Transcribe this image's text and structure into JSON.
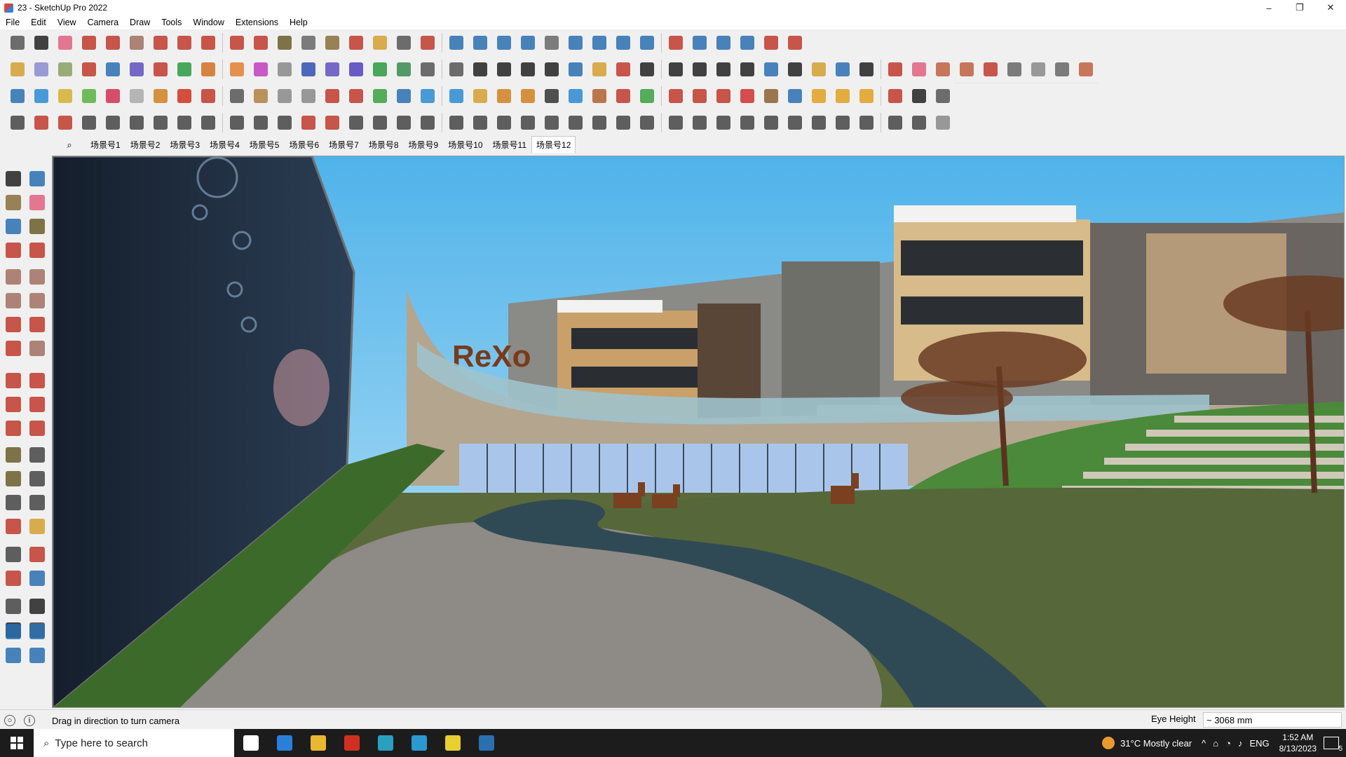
{
  "window": {
    "title": "23 - SketchUp Pro 2022",
    "minimize": "–",
    "maximize": "❐",
    "close": "✕"
  },
  "menu": [
    "File",
    "Edit",
    "View",
    "Camera",
    "Draw",
    "Tools",
    "Window",
    "Extensions",
    "Help"
  ],
  "toolbars": {
    "row1": [
      {
        "name": "zoom-icon",
        "color": "#555555"
      },
      {
        "name": "select-icon",
        "color": "#222222"
      },
      {
        "name": "eraser-icon",
        "color": "#e06080"
      },
      {
        "name": "pencil-icon",
        "color": "#c0392b"
      },
      {
        "name": "arc-icon",
        "color": "#c0392b"
      },
      {
        "name": "rectangle-icon",
        "color": "#a07060"
      },
      {
        "name": "push-pull-icon",
        "color": "#c0392b"
      },
      {
        "name": "follow-me-icon",
        "color": "#c0392b"
      },
      {
        "name": "move-icon",
        "color": "#c0392b"
      },
      {
        "name": "rotate-icon",
        "color": "#c0392b"
      },
      {
        "name": "scale-icon",
        "color": "#c0392b"
      },
      {
        "name": "tape-measure-icon",
        "color": "#6a5d2a"
      },
      {
        "name": "text-icon",
        "color": "#666666"
      },
      {
        "name": "paint-bucket-icon",
        "color": "#8a6d3b"
      },
      {
        "name": "orbit-icon",
        "color": "#c0392b"
      },
      {
        "name": "pan-icon",
        "color": "#d4a030"
      },
      {
        "name": "zoom-tool-icon",
        "color": "#555555"
      },
      {
        "name": "zoom-extents-icon",
        "color": "#c0392b"
      },
      {
        "name": "warehouse-icon",
        "color": "#2a6fb0"
      },
      {
        "name": "extension-warehouse-icon",
        "color": "#2a6fb0"
      },
      {
        "name": "layout-icon",
        "color": "#2a6fb0"
      },
      {
        "name": "extension-manager-icon",
        "color": "#2a6fb0"
      },
      {
        "name": "user-icon",
        "color": "#666666"
      },
      {
        "name": "section-plane-icon",
        "color": "#2a6fb0"
      },
      {
        "name": "section-display-icon",
        "color": "#2a6fb0"
      },
      {
        "name": "section-fill-icon",
        "color": "#2a6fb0"
      },
      {
        "name": "arrows-up-icon",
        "color": "#2a6fb0"
      },
      {
        "name": "arrows-down-icon",
        "color": "#c0392b"
      },
      {
        "name": "dimension-icon",
        "color": "#2a6fb0"
      },
      {
        "name": "model-info-icon",
        "color": "#2a6fb0"
      },
      {
        "name": "undo-icon",
        "color": "#2a6fb0"
      },
      {
        "name": "redo-icon",
        "color": "#c0392b"
      },
      {
        "name": "preferences-icon",
        "color": "#c0392b"
      }
    ],
    "row2": [
      {
        "name": "iso-view-icon",
        "color": "#d4a030"
      },
      {
        "name": "top-view-icon",
        "color": "#8a8ad0"
      },
      {
        "name": "front-view-icon",
        "color": "#8aa060"
      },
      {
        "name": "push-pull-red-icon",
        "color": "#c0392b"
      },
      {
        "name": "extrude-blue-icon",
        "color": "#2a6fb0"
      },
      {
        "name": "extrude-purple-icon",
        "color": "#6050c0"
      },
      {
        "name": "extrude-red-icon",
        "color": "#c0392b"
      },
      {
        "name": "extrude-green-icon",
        "color": "#2a9a40"
      },
      {
        "name": "extrude-orange-icon",
        "color": "#d07020"
      },
      {
        "name": "extrude-orange2-icon",
        "color": "#e08030"
      },
      {
        "name": "extrude-magenta-icon",
        "color": "#c040c0"
      },
      {
        "name": "curve-icon",
        "color": "#888888"
      },
      {
        "name": "face-blue-icon",
        "color": "#3050b0"
      },
      {
        "name": "face-purple-icon",
        "color": "#6050c0"
      },
      {
        "name": "face-violet-icon",
        "color": "#5040c0"
      },
      {
        "name": "plane-green-icon",
        "color": "#2a9a40"
      },
      {
        "name": "plane-green2-icon",
        "color": "#3a8a50"
      },
      {
        "name": "house-icon",
        "color": "#555555"
      },
      {
        "name": "house2-icon",
        "color": "#555555"
      },
      {
        "name": "house3-icon",
        "color": "#222222"
      },
      {
        "name": "house4-icon",
        "color": "#222222"
      },
      {
        "name": "house5-icon",
        "color": "#222222"
      },
      {
        "name": "house6-icon",
        "color": "#222222"
      },
      {
        "name": "graph-icon",
        "color": "#2a6fb0"
      },
      {
        "name": "shape-icon",
        "color": "#d4a030"
      },
      {
        "name": "pencil-red-icon",
        "color": "#c0392b"
      },
      {
        "name": "shape-square-icon",
        "color": "#222222"
      },
      {
        "name": "shape-circle-icon",
        "color": "#222222"
      },
      {
        "name": "shape-hexagon-icon",
        "color": "#222222"
      },
      {
        "name": "shape-ellipse-icon",
        "color": "#222222"
      },
      {
        "name": "shape-parallelogram-icon",
        "color": "#222222"
      },
      {
        "name": "shape-arc-icon",
        "color": "#2a6fb0"
      },
      {
        "name": "shape-ring-icon",
        "color": "#222222"
      },
      {
        "name": "shape-spiral-icon",
        "color": "#d4a030"
      },
      {
        "name": "shape-polygon-icon",
        "color": "#2a6fb0"
      },
      {
        "name": "shape-torus-icon",
        "color": "#222222"
      },
      {
        "name": "line-red-icon",
        "color": "#c0392b"
      },
      {
        "name": "eraser-pink-icon",
        "color": "#e06080"
      },
      {
        "name": "render-1-icon",
        "color": "#c06040"
      },
      {
        "name": "render-2-icon",
        "color": "#c06040"
      },
      {
        "name": "render-3-icon",
        "color": "#c0392b"
      },
      {
        "name": "render-4-icon",
        "color": "#666666"
      },
      {
        "name": "render-5-icon",
        "color": "#888888"
      },
      {
        "name": "render-6-icon",
        "color": "#666666"
      },
      {
        "name": "render-7-icon",
        "color": "#c06040"
      }
    ],
    "row3": [
      {
        "name": "layer-1-icon",
        "color": "#2a6fb0"
      },
      {
        "name": "layer-2-icon",
        "color": "#2a8ad0"
      },
      {
        "name": "layer-3-icon",
        "color": "#d4b030"
      },
      {
        "name": "layer-4-icon",
        "color": "#5ab040"
      },
      {
        "name": "layer-5-icon",
        "color": "#d03050"
      },
      {
        "name": "layer-6-icon",
        "color": "#aaaaaa"
      },
      {
        "name": "curl-icon",
        "color": "#d08020"
      },
      {
        "name": "stop-icon",
        "color": "#d03020"
      },
      {
        "name": "grid-icon",
        "color": "#c0392b"
      },
      {
        "name": "wall-icon",
        "color": "#555555"
      },
      {
        "name": "box-icon",
        "color": "#b08040"
      },
      {
        "name": "chain-icon",
        "color": "#888888"
      },
      {
        "name": "bend-icon",
        "color": "#888888"
      },
      {
        "name": "dots-curve-icon",
        "color": "#c0392b"
      },
      {
        "name": "plus-red-icon",
        "color": "#c0392b"
      },
      {
        "name": "plus-green-icon",
        "color": "#3aa040"
      },
      {
        "name": "x-blue-icon",
        "color": "#2a6fb0"
      },
      {
        "name": "flask-icon",
        "color": "#2a8ad0"
      },
      {
        "name": "flask2-icon",
        "color": "#2a8ad0"
      },
      {
        "name": "triangle-icon",
        "color": "#d4a030"
      },
      {
        "name": "ring-orange-icon",
        "color": "#d08020"
      },
      {
        "name": "ring-x-icon",
        "color": "#d08020"
      },
      {
        "name": "ring-dots-icon",
        "color": "#333333"
      },
      {
        "name": "star-icon",
        "color": "#2a8ad0"
      },
      {
        "name": "cup-icon",
        "color": "#b06030"
      },
      {
        "name": "magnet-icon",
        "color": "#c0392b"
      },
      {
        "name": "tree-icon",
        "color": "#3aa040"
      },
      {
        "name": "hammer-icon",
        "color": "#c0392b"
      },
      {
        "name": "tool-a-icon",
        "color": "#c0392b"
      },
      {
        "name": "tool-b-icon",
        "color": "#c0392b"
      },
      {
        "name": "gem-icon",
        "color": "#d03030"
      },
      {
        "name": "net-icon",
        "color": "#8a6030"
      },
      {
        "name": "cube-outline-icon",
        "color": "#2a6fb0"
      },
      {
        "name": "hatch-orange-icon",
        "color": "#e0a020"
      },
      {
        "name": "grid-orange-icon",
        "color": "#e0a020"
      },
      {
        "name": "grid-yellow-icon",
        "color": "#e0a020"
      },
      {
        "name": "scatter-icon",
        "color": "#c0392b"
      },
      {
        "name": "dotted-curve-icon",
        "color": "#222222"
      },
      {
        "name": "component-icon",
        "color": "#555555"
      }
    ],
    "row4": [
      {
        "name": "path-1-icon",
        "color": "#444444"
      },
      {
        "name": "path-2-icon",
        "color": "#c0392b"
      },
      {
        "name": "path-3-icon",
        "color": "#c0392b"
      },
      {
        "name": "path-4-icon",
        "color": "#444444"
      },
      {
        "name": "sphere-icon",
        "color": "#444444"
      },
      {
        "name": "loft-icon",
        "color": "#444444"
      },
      {
        "name": "sweep-icon",
        "color": "#444444"
      },
      {
        "name": "shell-icon",
        "color": "#444444"
      },
      {
        "name": "twist-icon",
        "color": "#444444"
      },
      {
        "name": "bend2-icon",
        "color": "#444444"
      },
      {
        "name": "corner-icon",
        "color": "#444444"
      },
      {
        "name": "corner2-icon",
        "color": "#444444"
      },
      {
        "name": "trim-icon",
        "color": "#c0392b"
      },
      {
        "name": "offset-icon",
        "color": "#c0392b"
      },
      {
        "name": "mesh-icon",
        "color": "#444444"
      },
      {
        "name": "fold-icon",
        "color": "#444444"
      },
      {
        "name": "stairs-icon",
        "color": "#444444"
      },
      {
        "name": "stairs2-icon",
        "color": "#444444"
      },
      {
        "name": "stairs3-icon",
        "color": "#444444"
      },
      {
        "name": "leaf-icon",
        "color": "#444444"
      },
      {
        "name": "fan-icon",
        "color": "#444444"
      },
      {
        "name": "stack-icon",
        "color": "#444444"
      },
      {
        "name": "slope-icon",
        "color": "#444444"
      },
      {
        "name": "lines-icon",
        "color": "#444444"
      },
      {
        "name": "lines2-icon",
        "color": "#444444"
      },
      {
        "name": "lines3-icon",
        "color": "#444444"
      },
      {
        "name": "house-3d-icon",
        "color": "#444444"
      },
      {
        "name": "stripes-icon",
        "color": "#444444"
      },
      {
        "name": "panel-icon",
        "color": "#444444"
      },
      {
        "name": "panel2-icon",
        "color": "#444444"
      },
      {
        "name": "columns-icon",
        "color": "#444444"
      },
      {
        "name": "hatch-icon",
        "color": "#444444"
      },
      {
        "name": "hatch2-icon",
        "color": "#444444"
      },
      {
        "name": "bars-icon",
        "color": "#444444"
      },
      {
        "name": "wheel-icon",
        "color": "#444444"
      },
      {
        "name": "wheel2-icon",
        "color": "#444444"
      },
      {
        "name": "ramp-icon",
        "color": "#444444"
      },
      {
        "name": "roof-icon",
        "color": "#444444"
      },
      {
        "name": "cloud-icon",
        "color": "#888888"
      }
    ]
  },
  "scenes": {
    "search_icon": "⌕",
    "tabs": [
      "场景号1",
      "场景号2",
      "场景号3",
      "场景号4",
      "场景号5",
      "场景号6",
      "场景号7",
      "场景号8",
      "场景号9",
      "场景号10",
      "场景号11",
      "场景号12"
    ],
    "active_index": 11
  },
  "left_toolbar": [
    {
      "name": "select-tool-icon",
      "color": "#222222"
    },
    {
      "name": "orbit-tool-icon",
      "color": "#2a6fb0"
    },
    {
      "name": "paint-tool-icon",
      "color": "#8a6d3b"
    },
    {
      "name": "eraser-tool-icon",
      "color": "#e06080"
    },
    {
      "name": "component-tool-icon",
      "color": "#2a6fb0"
    },
    {
      "name": "tape-tool-icon",
      "color": "#6a5d2a"
    },
    {
      "name": "line-tool-icon",
      "color": "#c0392b"
    },
    {
      "name": "freehand-tool-icon",
      "color": "#c0392b"
    },
    {
      "name": "rectangle-tool-icon",
      "color": "#a07060"
    },
    {
      "name": "rotated-rect-tool-icon",
      "color": "#a07060"
    },
    {
      "name": "circle-tool-icon",
      "color": "#a07060"
    },
    {
      "name": "polygon-tool-icon",
      "color": "#a07060"
    },
    {
      "name": "arc-tool-icon",
      "color": "#c0392b"
    },
    {
      "name": "arc2-tool-icon",
      "color": "#c0392b"
    },
    {
      "name": "arc3-tool-icon",
      "color": "#c0392b"
    },
    {
      "name": "pie-tool-icon",
      "color": "#a07060"
    },
    {
      "name": "move-tool-icon",
      "color": "#c0392b"
    },
    {
      "name": "pushpull-tool-icon",
      "color": "#c0392b"
    },
    {
      "name": "rotate-tool-icon",
      "color": "#c0392b"
    },
    {
      "name": "followme-tool-icon",
      "color": "#c0392b"
    },
    {
      "name": "scale-tool-icon",
      "color": "#c0392b"
    },
    {
      "name": "offset-tool-icon",
      "color": "#c0392b"
    },
    {
      "name": "tape2-tool-icon",
      "color": "#6a5d2a"
    },
    {
      "name": "dimension-tool-icon",
      "color": "#444444"
    },
    {
      "name": "protractor-tool-icon",
      "color": "#6a5d2a"
    },
    {
      "name": "text-tool-icon",
      "color": "#444444"
    },
    {
      "name": "axes-tool-icon",
      "color": "#444444"
    },
    {
      "name": "3dtext-tool-icon",
      "color": "#444444"
    },
    {
      "name": "orbit2-tool-icon",
      "color": "#c0392b"
    },
    {
      "name": "pan-tool-icon",
      "color": "#d4a030"
    },
    {
      "name": "zoom-tool2-icon",
      "color": "#444444"
    },
    {
      "name": "zoom-window-tool-icon",
      "color": "#c0392b"
    },
    {
      "name": "zoom-extents-tool-icon",
      "color": "#c0392b"
    },
    {
      "name": "previous-tool-icon",
      "color": "#2a6fb0"
    },
    {
      "name": "position-camera-icon",
      "color": "#444444"
    },
    {
      "name": "look-around-icon",
      "color": "#222222"
    },
    {
      "name": "walk-icon",
      "color": "#222222"
    },
    {
      "name": "section-tool-icon",
      "color": "#444444"
    },
    {
      "name": "warehouse-tool-icon",
      "color": "#2a6fb0"
    },
    {
      "name": "ext-warehouse-tool-icon",
      "color": "#2a6fb0"
    },
    {
      "name": "layout-tool-icon",
      "color": "#2a6fb0"
    },
    {
      "name": "ext-manager-tool-icon",
      "color": "#2a6fb0"
    }
  ],
  "viewport": {
    "logo_text": "ReXo"
  },
  "status": {
    "hint": "Drag in direction to turn camera",
    "vcb_label": "Eye Height",
    "vcb_value": "~ 3068 mm",
    "info_icon": "i",
    "geo_icon": "○"
  },
  "taskbar": {
    "search_placeholder": "Type here to search",
    "weather": "31°C  Mostly clear",
    "language": "ENG",
    "time": "1:52 AM",
    "date": "8/13/2023",
    "notification_count": "5",
    "apps": [
      {
        "name": "task-view-icon",
        "color": "#ffffff"
      },
      {
        "name": "calculator-icon",
        "color": "#2a7fd8"
      },
      {
        "name": "file-explorer-icon",
        "color": "#e8b830"
      },
      {
        "name": "acrobat-icon",
        "color": "#d03020"
      },
      {
        "name": "calendar-app-icon",
        "color": "#2aa0c0"
      },
      {
        "name": "edge-icon",
        "color": "#2a9ad0"
      },
      {
        "name": "sticky-notes-icon",
        "color": "#e8d030"
      },
      {
        "name": "sketchup-icon",
        "color": "#2a6fb0"
      }
    ]
  }
}
